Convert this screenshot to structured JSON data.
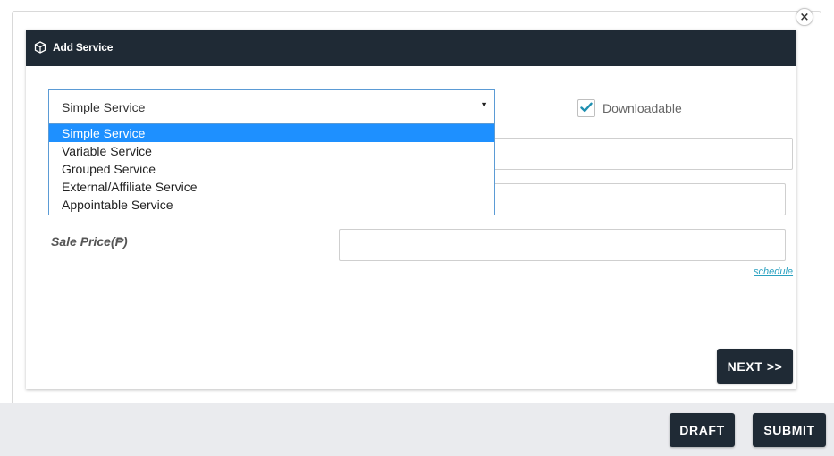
{
  "modal": {
    "title": "Add Service",
    "close_symbol": "×",
    "header_icon": "cube-icon"
  },
  "service_type": {
    "selected": "Simple Service",
    "options": [
      "Simple Service",
      "Variable Service",
      "Grouped Service",
      "External/Affiliate Service",
      "Appointable Service"
    ],
    "highlighted_index": 0
  },
  "downloadable": {
    "label": "Downloadable",
    "checked": true
  },
  "sale_price": {
    "label": "Sale Price(₱)",
    "value": ""
  },
  "schedule_link": "schedule",
  "buttons": {
    "next": "NEXT >>",
    "draft": "DRAFT",
    "submit": "SUBMIT"
  },
  "colors": {
    "header_bg": "#1f2a35",
    "button_bg": "#1f2a35",
    "highlight": "#1e90ff",
    "checkmark": "#1f8fb0",
    "link": "#2aa1c0"
  }
}
